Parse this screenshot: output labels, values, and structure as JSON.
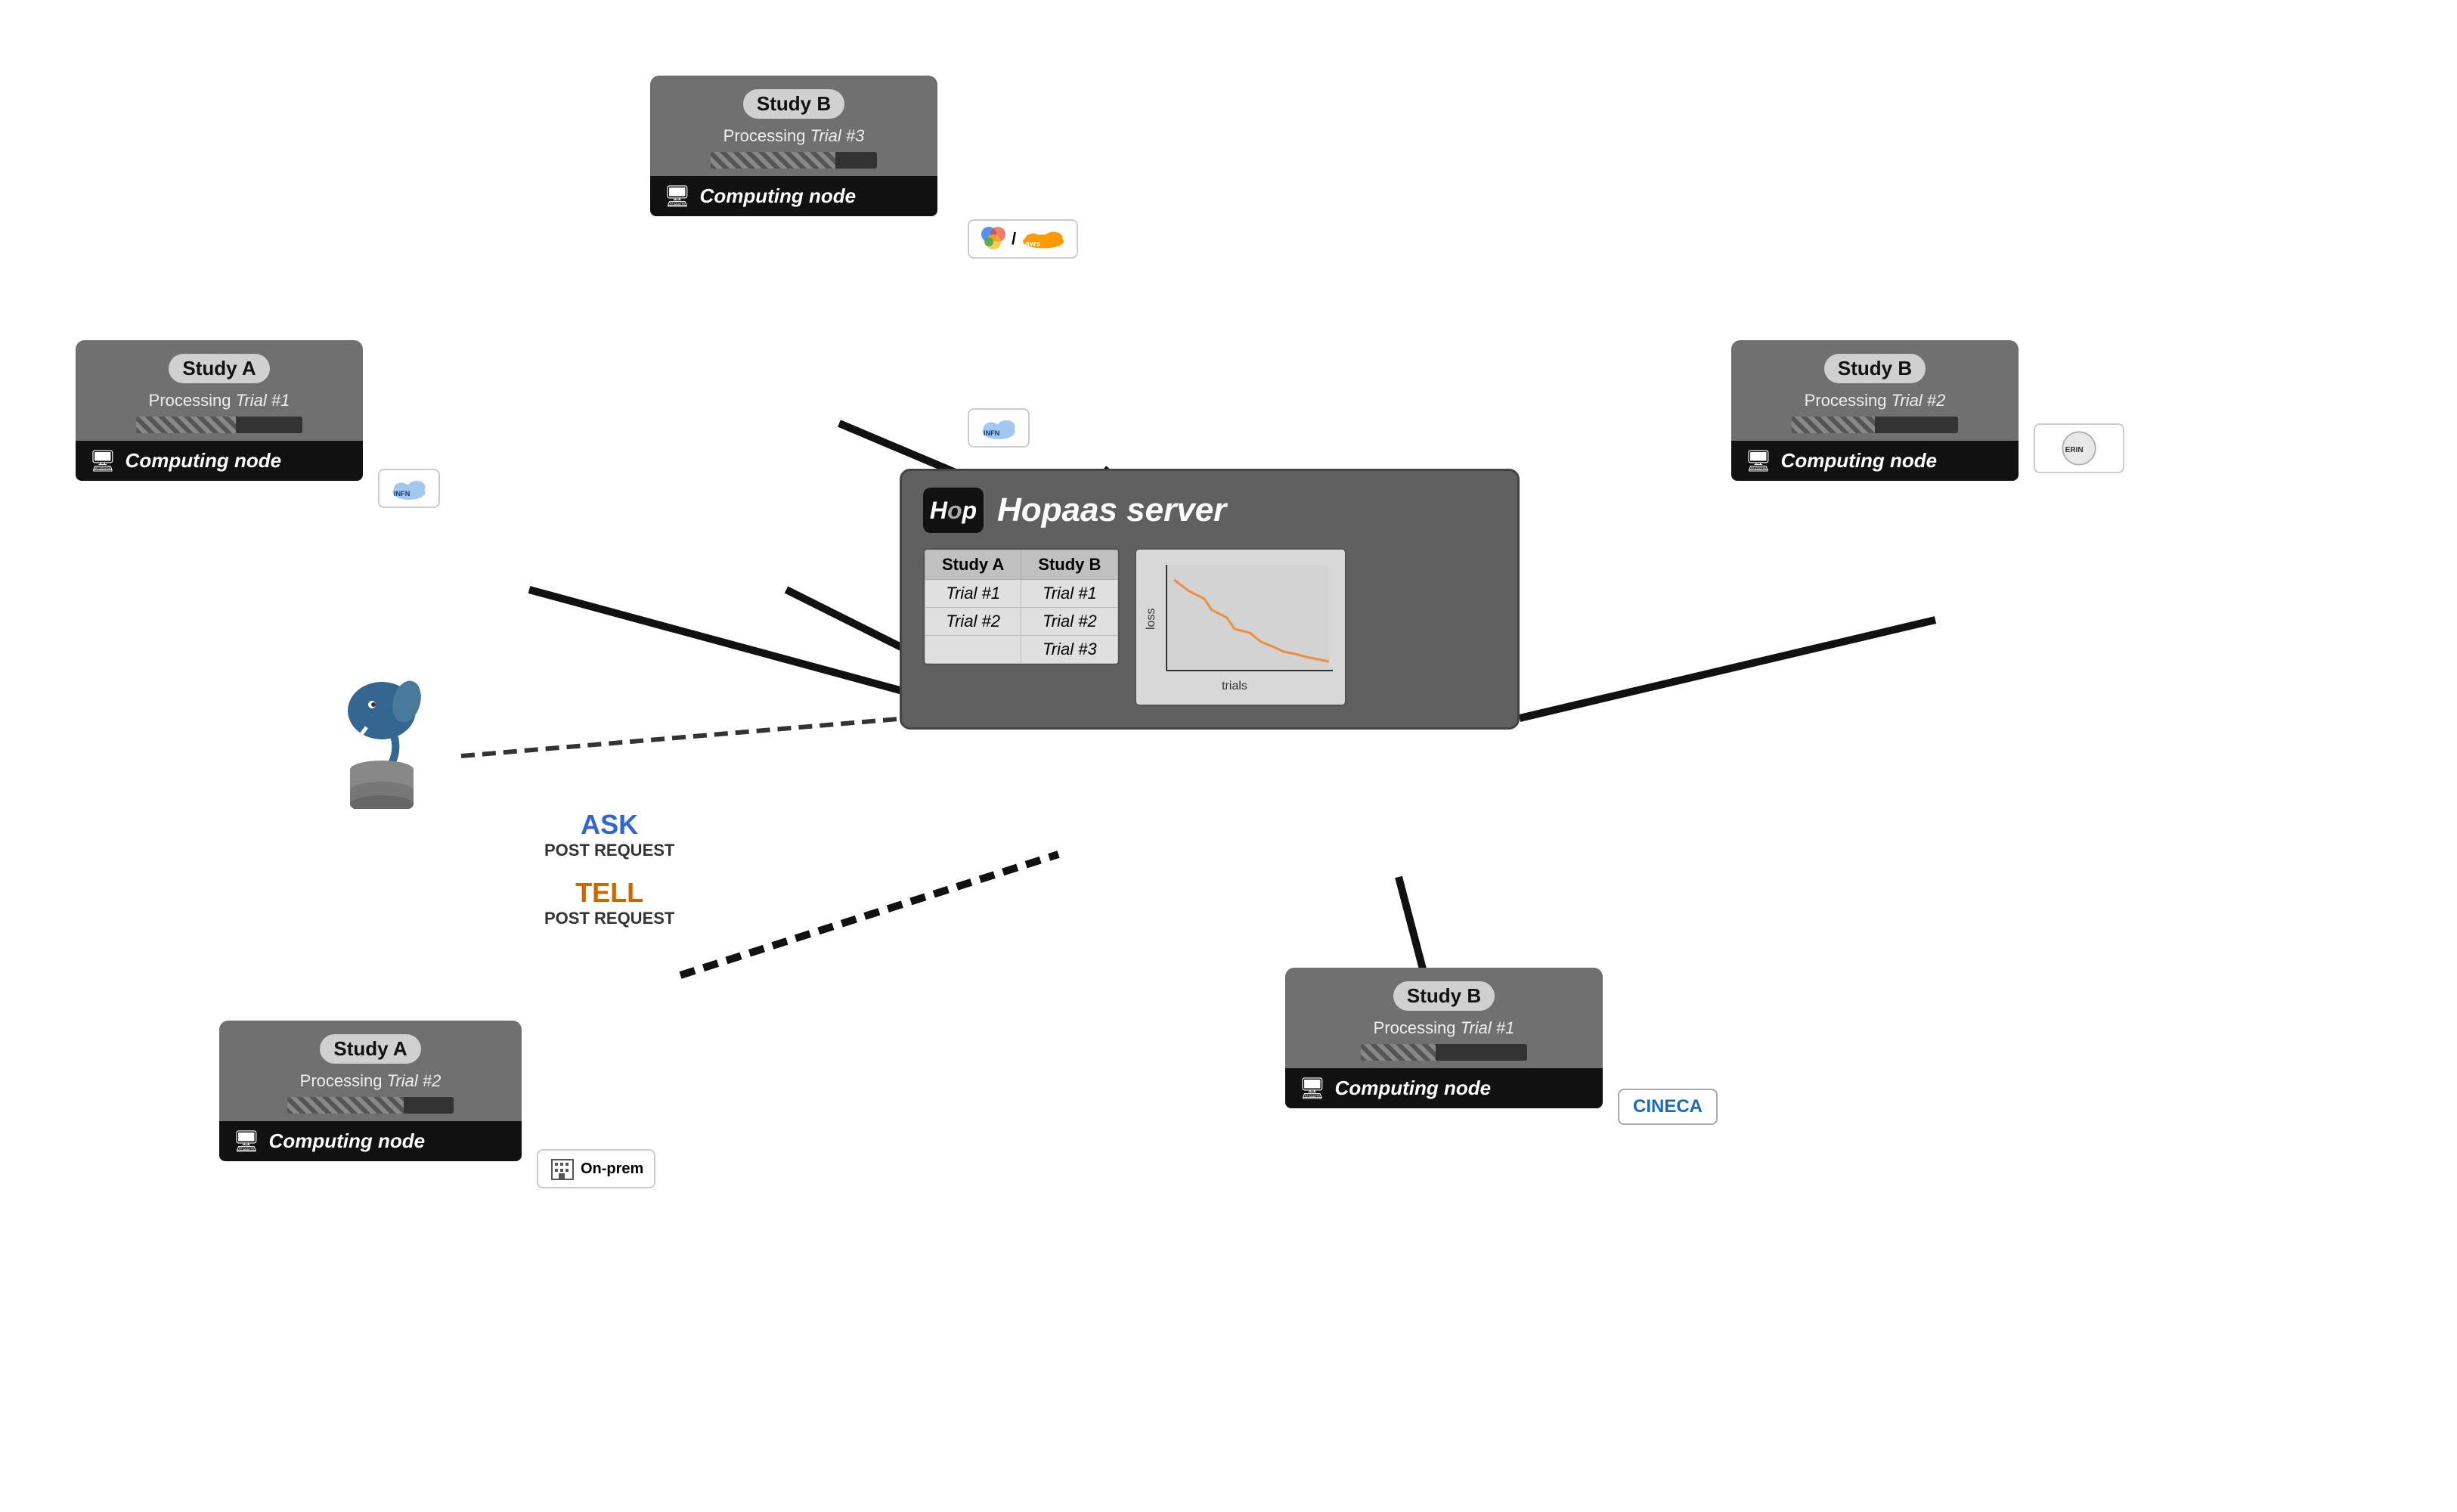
{
  "server": {
    "logo": "Hop",
    "title": "Hopaas server",
    "table": {
      "col1": "Study A",
      "col2": "Study B",
      "rows": [
        [
          "Trial #1",
          "Trial #1"
        ],
        [
          "Trial #2",
          "Trial #2"
        ],
        [
          "",
          "Trial #3"
        ]
      ]
    },
    "chart": {
      "x_label": "trials",
      "y_label": "loss"
    }
  },
  "nodes": {
    "top_left": {
      "study": "Study A",
      "processing": "Processing",
      "trial": "Trial #1",
      "node_label": "Computing node",
      "provider": "INFN",
      "progress": 60
    },
    "top_center": {
      "study": "Study B",
      "processing": "Processing",
      "trial": "Trial #3",
      "node_label": "Computing node",
      "provider": "Cloud / AWS",
      "progress": 75
    },
    "top_right": {
      "study": "Study B",
      "processing": "Processing",
      "trial": "Trial #2",
      "node_label": "Computing node",
      "provider": "ERIN",
      "progress": 50
    },
    "bottom_left": {
      "study": "Study A",
      "processing": "Processing",
      "trial": "Trial #2",
      "node_label": "Computing node",
      "provider": "On-prem",
      "progress": 70
    },
    "bottom_right": {
      "study": "Study B",
      "processing": "Processing",
      "trial": "Trial #1",
      "node_label": "Computing node",
      "provider": "CINECA",
      "progress": 45
    }
  },
  "labels": {
    "ask": "ASK",
    "ask_sub": "POST REQUEST",
    "tell": "TELL",
    "tell_sub": "POST REQUEST"
  }
}
